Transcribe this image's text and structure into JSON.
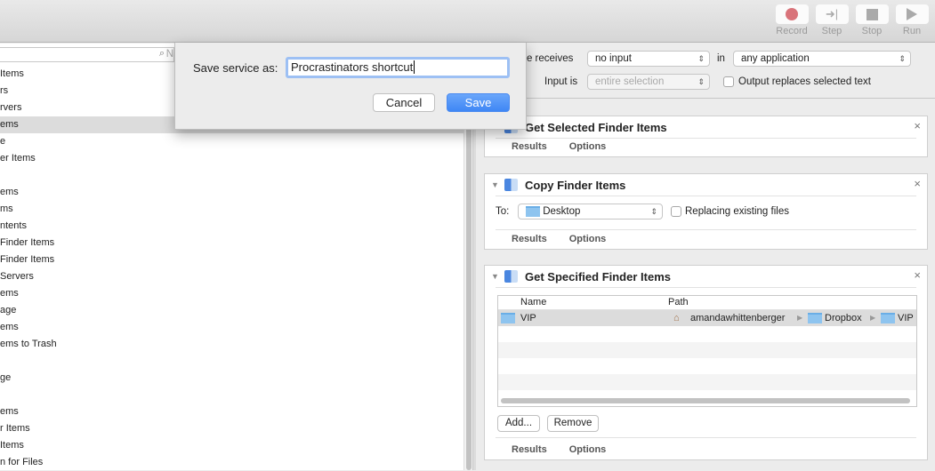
{
  "toolbar": {
    "buttons": [
      {
        "label": "Record",
        "icon": "record-icon"
      },
      {
        "label": "Step",
        "icon": "step-icon"
      },
      {
        "label": "Stop",
        "icon": "stop-icon"
      },
      {
        "label": "Run",
        "icon": "run-icon"
      }
    ],
    "record_color": "#d9737a"
  },
  "library": {
    "search_placeholder": "N",
    "items": [
      "Items",
      "rs",
      "rvers",
      "ems",
      "e",
      "er Items",
      "",
      "ems",
      "ms",
      "ntents",
      "Finder Items",
      "Finder Items",
      "Servers",
      "ems",
      "age",
      "ems",
      "ems to Trash",
      "",
      "ge",
      "",
      "ems",
      "r Items",
      "Items",
      "n for Files"
    ],
    "selected_index": 3
  },
  "service": {
    "receives_label": "Service receives",
    "receives_value": "no input",
    "in_label": "in",
    "app_value": "any application",
    "input_is_label": "Input is",
    "input_is_value": "entire selection",
    "output_replaces_label": "Output replaces selected text",
    "output_replaces_checked": false
  },
  "actions": [
    {
      "title": "Get Selected Finder Items",
      "tabs": [
        "Results",
        "Options"
      ]
    },
    {
      "title": "Copy Finder Items",
      "to_label": "To:",
      "to_value": "Desktop",
      "replacing_label": "Replacing existing files",
      "replacing_checked": false,
      "tabs": [
        "Results",
        "Options"
      ]
    },
    {
      "title": "Get Specified Finder Items",
      "columns": [
        "Name",
        "Path"
      ],
      "rows": [
        {
          "name": "VIP",
          "path": [
            "amandawhittenberger",
            "Dropbox",
            "VIP"
          ]
        }
      ],
      "add_label": "Add...",
      "remove_label": "Remove",
      "tabs": [
        "Results",
        "Options"
      ]
    }
  ],
  "dialog": {
    "label": "Save service as:",
    "value": "Procrastinators shortcut",
    "cancel": "Cancel",
    "save": "Save",
    "accent": "#3f87f5"
  }
}
